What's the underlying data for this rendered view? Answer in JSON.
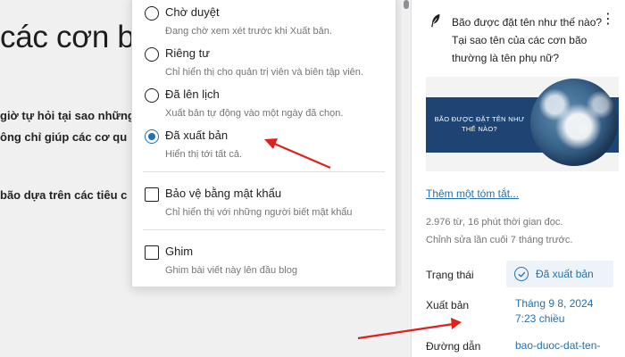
{
  "editor": {
    "title_fragment": "các cơn bã",
    "paragraphs": [
      "giờ tự hỏi tại sao những",
      "ông chỉ giúp các cơ qu",
      "bão dựa trên các tiêu c"
    ]
  },
  "visibility": {
    "options": [
      {
        "label": "Chờ duyệt",
        "description": "Đang chờ xem xét trước khi Xuất bản."
      },
      {
        "label": "Riêng tư",
        "description": "Chỉ hiển thị cho quản trị viên và biên tập viên."
      },
      {
        "label": "Đã lên lịch",
        "description": "Xuất bản tự động vào một ngày đã chọn."
      },
      {
        "label": "Đã xuất bản",
        "description": "Hiển thị tới tất cả."
      }
    ],
    "selected": "Đã xuất bản",
    "password": {
      "label": "Bảo vệ bằng mật khẩu",
      "description": "Chỉ hiển thị với những người biết mật khẩu"
    },
    "sticky": {
      "label": "Ghim",
      "description": "Ghim bài viết này lên đầu blog"
    }
  },
  "sidebar": {
    "post_title": "Bão được đặt tên như thế nào? Tại sao tên của các cơn bão thường là tên phụ nữ?",
    "featured_image_text": "BÃO ĐƯỢC ĐẶT TÊN NHƯ THẾ NÀO?",
    "excerpt_link": "Thêm một tóm tắt...",
    "stats": "2.976 từ, 16 phút thời gian đọc.",
    "last_edited": "Chỉnh sửa lần cuối 7 tháng trước.",
    "status_label": "Trạng thái",
    "status_value": "Đã xuất bản",
    "publish_label": "Xuất bản",
    "publish_date": "Tháng 9 8, 2024",
    "publish_time": "7:23 chiều",
    "slug_label": "Đường dẫn",
    "slug_value": "bao-duoc-dat-ten-"
  },
  "colors": {
    "accent": "#2271b1",
    "annotation_arrow": "#e0211b",
    "banner": "#1d4472"
  },
  "icons": {
    "post_icon": "feather-icon",
    "more": "more-vertical-icon",
    "status": "check-circle-icon"
  }
}
